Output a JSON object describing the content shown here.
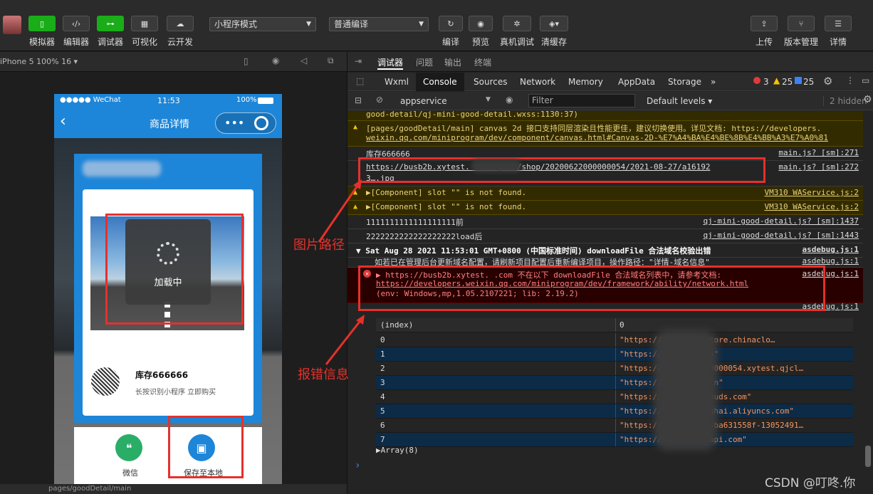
{
  "toolbar": {
    "buttons": [
      {
        "label": "模拟器"
      },
      {
        "label": "编辑器"
      },
      {
        "label": "调试器"
      },
      {
        "label": "可视化"
      },
      {
        "label": "云开发"
      }
    ],
    "mode_select": "小程序模式",
    "compile_select": "普通编译",
    "actions": [
      {
        "label": "编译"
      },
      {
        "label": "预览"
      },
      {
        "label": "真机调试"
      },
      {
        "label": "清缓存"
      }
    ],
    "right": [
      {
        "label": "上传"
      },
      {
        "label": "版本管理"
      },
      {
        "label": "详情"
      }
    ]
  },
  "simulator": {
    "device": "iPhone 5 100% 16 ▾",
    "status_left": "●●●●● WeChat",
    "status_time": "11:53",
    "status_right": "100%",
    "nav_title": "商品详情",
    "loading_text": "加载中",
    "qr_title": "库存666666",
    "qr_subtitle": "长按识别小程序 立即购买",
    "share_wechat": "微信",
    "share_save": "保存至本地",
    "bottom_path": "pages/goodDetail/main"
  },
  "devtools": {
    "top_tabs": [
      {
        "label": "调试器"
      },
      {
        "label": "问题"
      },
      {
        "label": "输出"
      },
      {
        "label": "终端"
      }
    ],
    "tabs": [
      {
        "label": "Wxml"
      },
      {
        "label": "Console"
      },
      {
        "label": "Sources"
      },
      {
        "label": "Network"
      },
      {
        "label": "Memory"
      },
      {
        "label": "AppData"
      },
      {
        "label": "Storage"
      }
    ],
    "counts": {
      "errors": "3",
      "warnings": "25",
      "info": "25"
    },
    "context": "appservice",
    "filter_placeholder": "Filter",
    "levels": "Default levels ▾",
    "hidden": "2 hidden"
  },
  "console": {
    "rows": [
      {
        "msg": "good-detail/qj-mini-good-detail.wxss:1130:37)",
        "src": ""
      },
      {
        "msg": "[pages/goodDetail/main] canvas 2d 接口支持同层渲染且性能更佳，建议切换使用。详见文档: https://developers.",
        "msg2": "weixin.qq.com/miniprogram/dev/component/canvas.html#Canvas-2D-%E7%A4%BA%E4%BE%8B%E4%BB%A3%E7%A0%81",
        "src": ""
      },
      {
        "msg": "库存666666",
        "src": "main.js? [sm]:271"
      },
      {
        "msg": "https://busb2b.xytest.          .com/paas/shop/20200622000000054/2021-08-27/a16192",
        "msg2": "3….jpg",
        "src": "main.js? [sm]:272"
      },
      {
        "msg": "▶[Component] slot \"\" is not found.",
        "src": "VM310 WAService.js:2"
      },
      {
        "msg": "▶[Component] slot \"\" is not found.",
        "src": "VM310 WAService.js:2"
      },
      {
        "msg": "1111111111111111111前",
        "src": "qj-mini-good-detail.js? [sm]:1437"
      },
      {
        "msg": "2222222222222222222load后",
        "src": "qj-mini-good-detail.js? [sm]:1443"
      },
      {
        "msg": "▼ Sat Aug 28 2021 11:53:01 GMT+0800 (中国标准时间) downloadFile 合法域名校验出错",
        "src": "asdebug.js:1"
      },
      {
        "msg": "如若已在管理后台更新域名配置，请刷新项目配置后重新编译项目，操作路径：\"详情-域名信息\"",
        "src": "asdebug.js:1"
      },
      {
        "msg": "▶ https://busb2b.xytest.    .com 不在以下 downloadFile 合法域名列表中，请参考文档:",
        "msg2": "https://developers.weixin.qq.com/miniprogram/dev/framework/ability/network.html",
        "msg3": "(env: Windows,mp,1.05.2107221; lib: 2.19.2)",
        "src": "asdebug.js:1"
      },
      {
        "msg": "",
        "src": "asdebug.js:1"
      }
    ],
    "table_header": {
      "index": "(index)",
      "value": "0"
    },
    "table_rows": [
      {
        "i": "0",
        "v": "\"https://              a01.blob.core.chinaclo…"
      },
      {
        "i": "1",
        "v": "\"https://              .pg.com.cn\""
      },
      {
        "i": "2",
        "v": "\"https://          2020062200000054.xytest.qjcl…"
      },
      {
        "i": "3",
        "v": "\"https://c        .pg.com.cn\""
      },
      {
        "i": "4",
        "v": "\"https://m            est.qjclouds.com\""
      },
      {
        "i": "5",
        "v": "\"https://           s-cn-shanghai.aliyuncs.com\""
      },
      {
        "i": "6",
        "v": "\"https://     c      -0gmqh1sba631558f-13052491…"
      },
      {
        "i": "7",
        "v": "\"https://             centcloudapi.com\""
      }
    ],
    "array_label": "▶Array(8)",
    "prompt": "›"
  },
  "annotations": {
    "image_path": "图片路径",
    "error_info": "报错信息"
  },
  "watermark": "CSDN @叮咚.你",
  "colors": {
    "accent": "#1aad19",
    "nav": "#1e86d8",
    "annot": "#e5312c"
  }
}
